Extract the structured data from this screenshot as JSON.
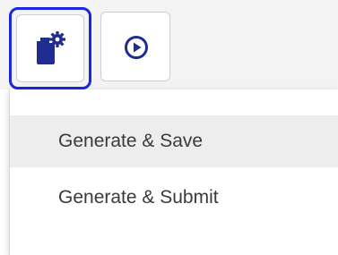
{
  "toolbar": {
    "buttons": [
      {
        "icon": "gear-document-icon",
        "state": "focused",
        "focus_color": "#1a26e0"
      },
      {
        "icon": "play-circle-icon",
        "state": "normal"
      }
    ]
  },
  "dropdown_menu": {
    "items": [
      {
        "label": "Generate & Save",
        "highlighted": true
      },
      {
        "label": "Generate & Submit",
        "highlighted": false
      }
    ]
  },
  "colors": {
    "icon_primary": "#1f2d8f",
    "focus_ring": "#1a26e0",
    "menu_text": "#3a3a3a",
    "menu_highlight": "#ededed"
  }
}
